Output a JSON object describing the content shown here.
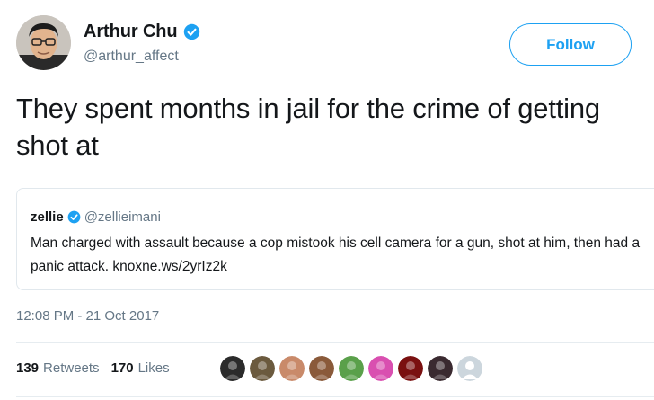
{
  "author": {
    "display_name": "Arthur Chu",
    "handle": "@arthur_affect",
    "verified": true,
    "avatar_icon": "user-avatar-photo"
  },
  "follow_button": {
    "label": "Follow"
  },
  "tweet": {
    "text": "They spent months in jail for the crime of getting shot at"
  },
  "quoted_tweet": {
    "display_name": "zellie",
    "verified": true,
    "handle": "@zellieimani",
    "text": "Man charged with assault because a cop mistook his cell camera for a gun, shot at him, then had a panic attack. knoxne.ws/2yrIz2k"
  },
  "timestamp": "12:08 PM - 21 Oct 2017",
  "stats": {
    "retweets_count": "139",
    "retweets_label": "Retweets",
    "likes_count": "170",
    "likes_label": "Likes"
  },
  "likers": [
    {
      "icon": "liker-avatar-1",
      "color": "#2b2b2b"
    },
    {
      "icon": "liker-avatar-2",
      "color": "#6b5a3e"
    },
    {
      "icon": "liker-avatar-3",
      "color": "#c98a6a"
    },
    {
      "icon": "liker-avatar-4",
      "color": "#8a5a3a"
    },
    {
      "icon": "liker-avatar-5",
      "color": "#5aa04a"
    },
    {
      "icon": "liker-avatar-6",
      "color": "#d94fb0"
    },
    {
      "icon": "liker-avatar-7",
      "color": "#7a1010"
    },
    {
      "icon": "liker-avatar-8",
      "color": "#3a2a30"
    },
    {
      "icon": "liker-avatar-default",
      "color": "#ccd6dd"
    }
  ],
  "colors": {
    "accent": "#1da1f2",
    "secondary_text": "#657786",
    "primary_text": "#14171a",
    "border": "#e1e8ed"
  }
}
